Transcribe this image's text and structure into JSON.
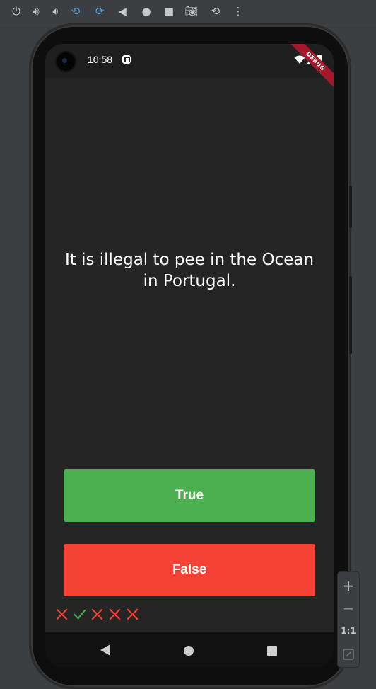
{
  "emulator_toolbar": {
    "icons": [
      "power-icon",
      "volume-up-icon",
      "volume-down-icon",
      "rotate-left-icon",
      "rotate-right-icon",
      "back-icon",
      "home-icon",
      "overview-icon",
      "camera-icon",
      "replay-icon",
      "more-icon"
    ]
  },
  "status_bar": {
    "time": "10:58",
    "debug_banner": "DEBUG"
  },
  "quiz": {
    "question": "It is illegal to pee in the Ocean in Portugal.",
    "true_label": "True",
    "false_label": "False",
    "score_keeper": [
      "wrong",
      "correct",
      "wrong",
      "wrong",
      "wrong"
    ]
  },
  "colors": {
    "true_button": "#4caf50",
    "false_button": "#f44336",
    "check": "#4caf50",
    "cross": "#f44336",
    "background": "#252525"
  },
  "zoom_controls": {
    "zoom_in": "+",
    "zoom_out": "−",
    "actual_size": "1:1"
  }
}
